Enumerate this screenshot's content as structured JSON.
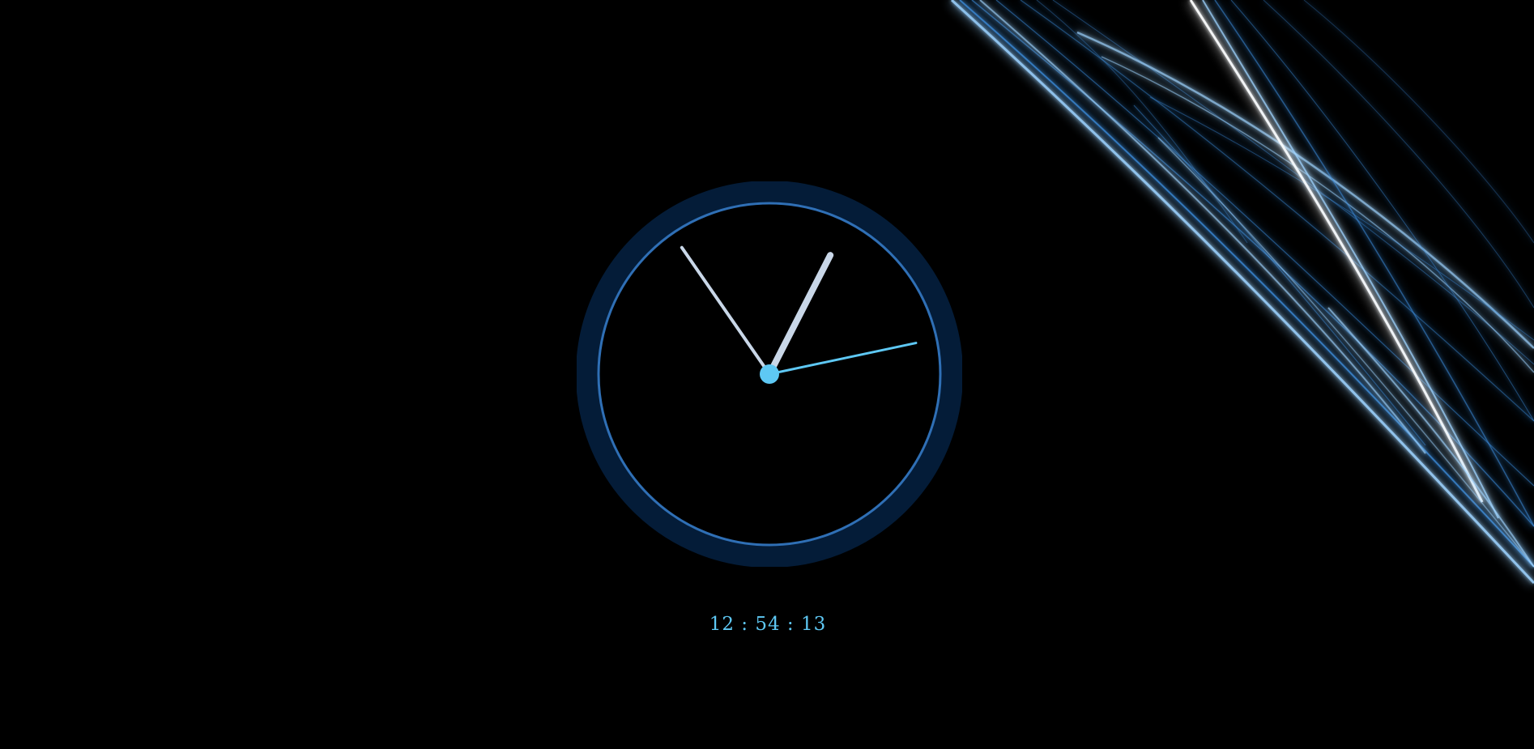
{
  "digital_clock": {
    "text": "12 : 54 : 13",
    "hours": 12,
    "minutes": 54,
    "seconds": 13
  },
  "colors": {
    "background": "#000000",
    "outer_ring": "#041c38",
    "inner_ring": "#2f6fb5",
    "hour_minute_hands": "#c9d7e8",
    "second_hand": "#5ec8f4",
    "center_dot": "#5ec8f4",
    "digital_text": "#5ec8f4",
    "streak_light": "#9fd4ff",
    "streak_mid": "#3d8fe0",
    "streak_white": "#ffffff"
  },
  "icons": {
    "clock": "analog-clock-icon",
    "decoration": "light-streaks"
  }
}
